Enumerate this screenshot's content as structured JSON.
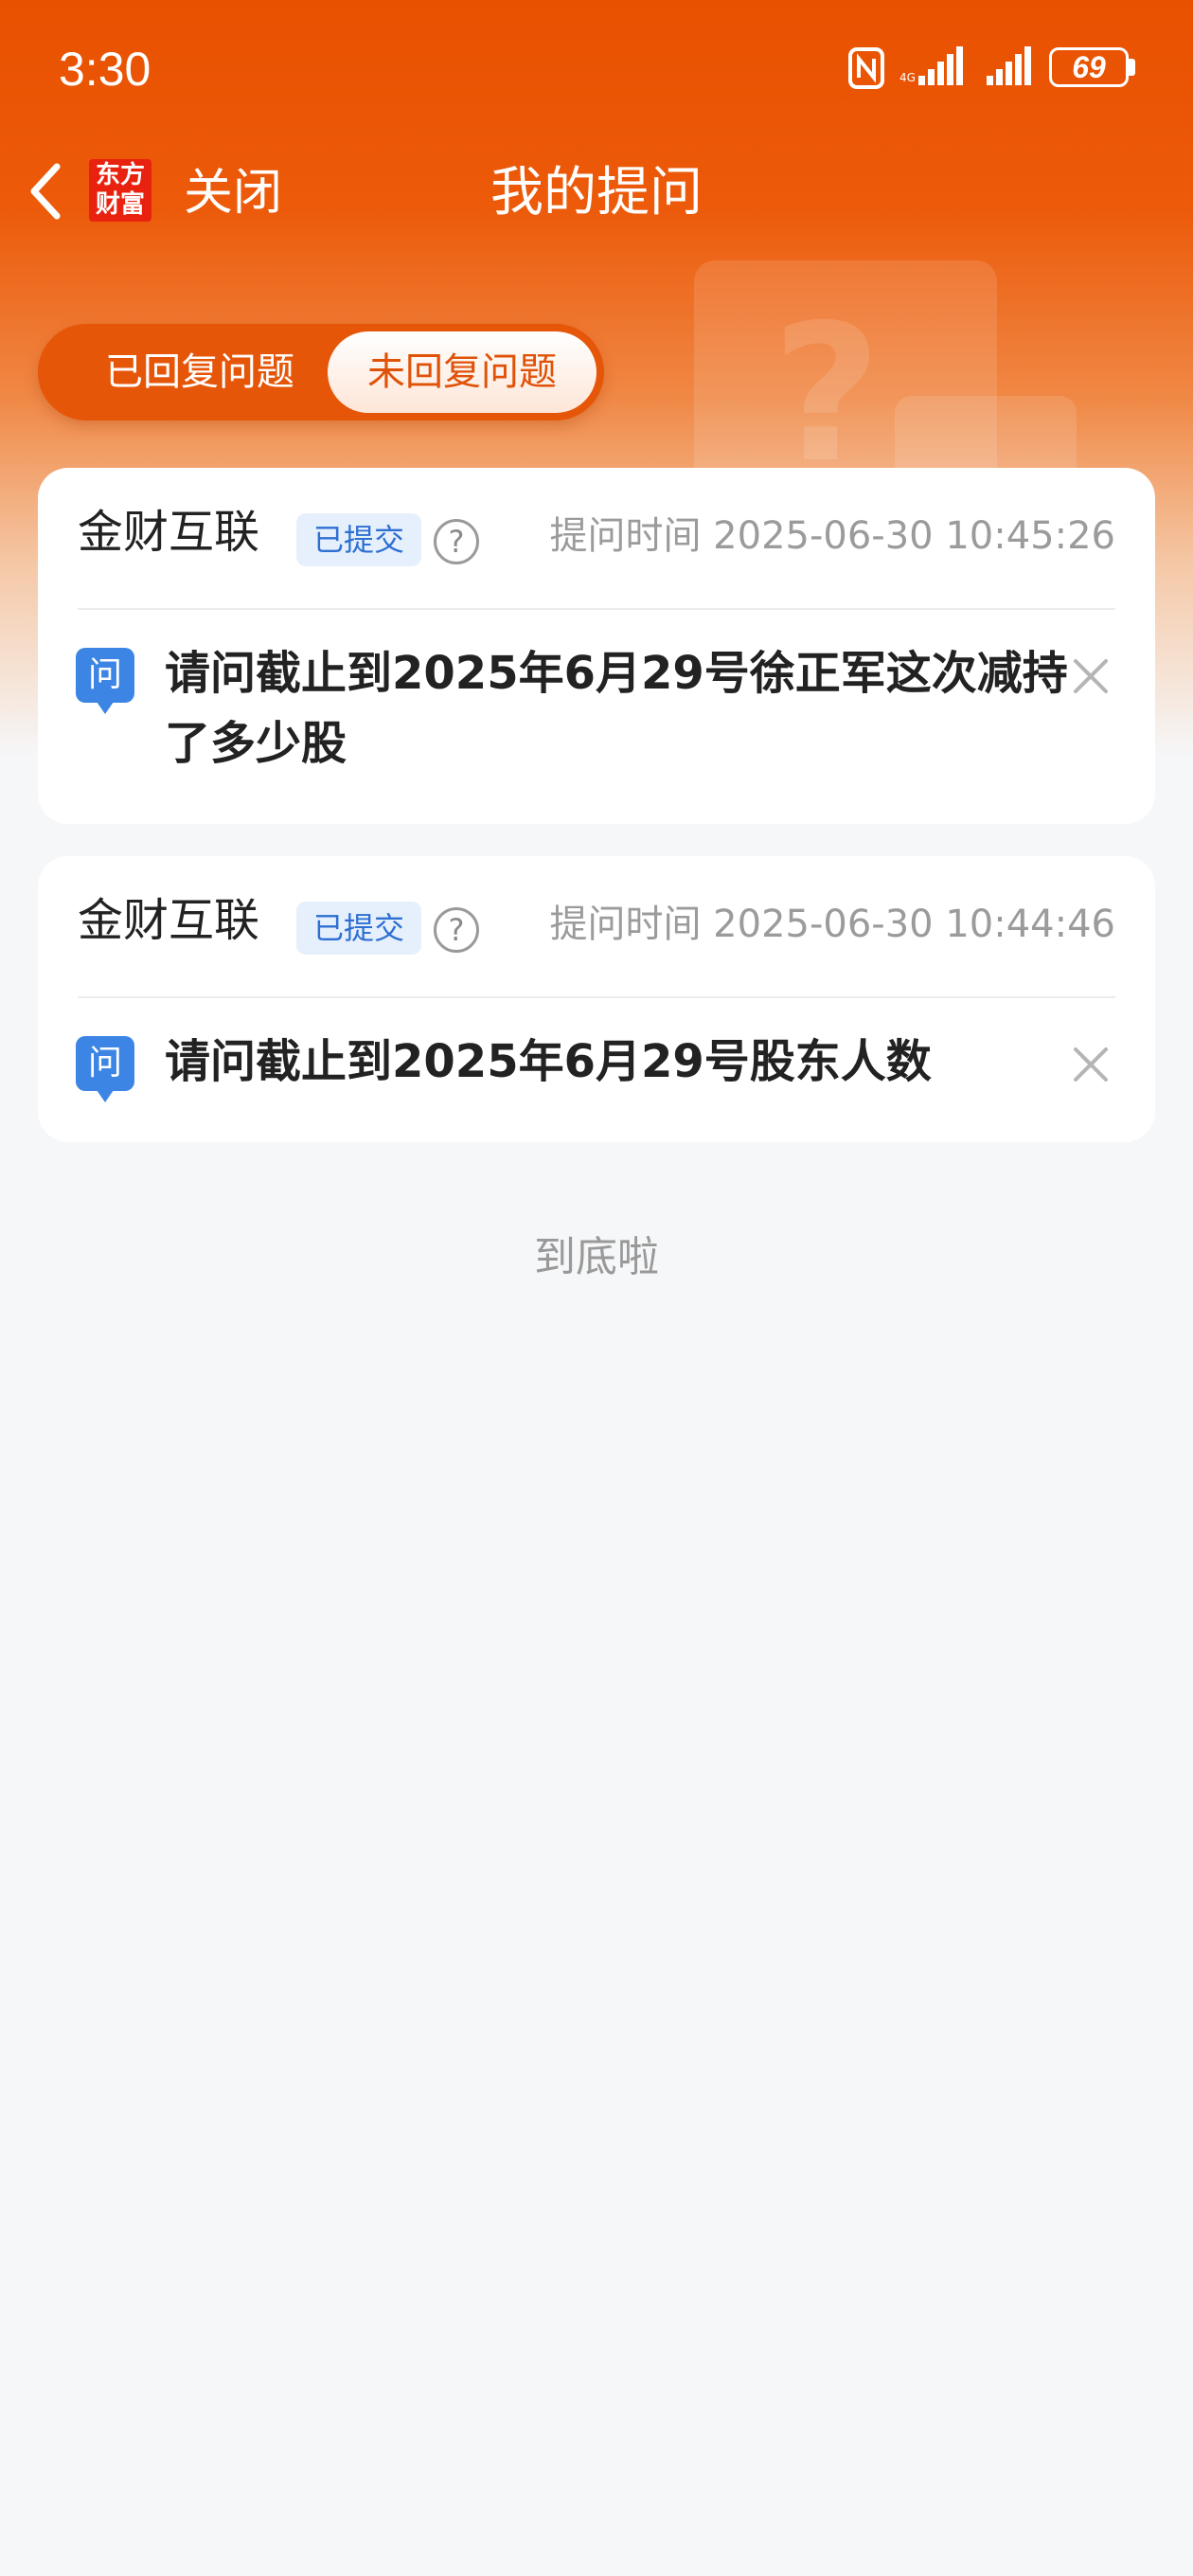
{
  "status_bar": {
    "time": "3:30",
    "battery": "69"
  },
  "nav": {
    "app_logo": "东方财富",
    "close_label": "关闭",
    "title": "我的提问"
  },
  "tabs": [
    {
      "label": "已回复问题",
      "selected": false
    },
    {
      "label": "未回复问题",
      "selected": true
    }
  ],
  "questions": [
    {
      "company": "金财互联",
      "status": "已提交",
      "time_label": "提问时间",
      "time": "2025-06-30 10:45:26",
      "q_badge": "问",
      "text": "请问截止到2025年6月29号徐正军这次减持了多少股"
    },
    {
      "company": "金财互联",
      "status": "已提交",
      "time_label": "提问时间",
      "time": "2025-06-30 10:44:46",
      "q_badge": "问",
      "text": "请问截止到2025年6月29号股东人数"
    }
  ],
  "footer": {
    "end_text": "到底啦"
  },
  "colors": {
    "brand": "#e85100",
    "badge_bg": "#e6f0fc",
    "badge_text": "#2d6fd2",
    "q_icon": "#3d85e5"
  }
}
